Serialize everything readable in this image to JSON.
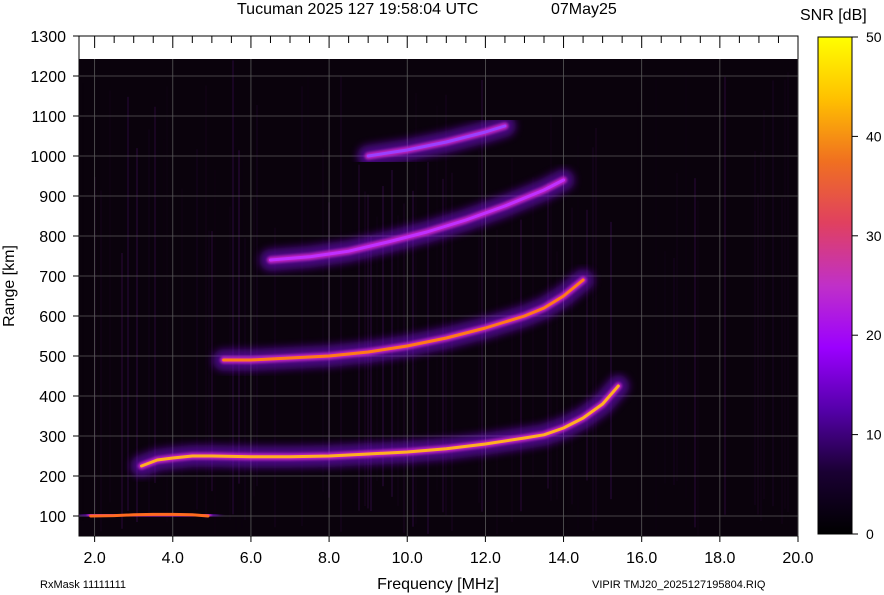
{
  "header": {
    "title": "Tucuman 2025 127 19:58:04 UTC",
    "date": "07May25",
    "colorbar_label": "SNR [dB]"
  },
  "footer": {
    "rxmask": "RxMask 11111111",
    "file": "VIPIR  TMJ20_2025127195804.RIQ"
  },
  "chart_data": {
    "type": "heatmap",
    "title": "Tucuman 2025 127 19:58:04 UTC",
    "xlabel": "Frequency [MHz]",
    "ylabel": "Range [km]",
    "xlim": [
      1.6,
      20.0
    ],
    "ylim": [
      50,
      1300
    ],
    "x_ticks": [
      "2.0",
      "4.0",
      "6.0",
      "8.0",
      "10.0",
      "12.0",
      "14.0",
      "16.0",
      "18.0",
      "20.0"
    ],
    "y_ticks": [
      "100",
      "200",
      "300",
      "400",
      "500",
      "600",
      "700",
      "800",
      "900",
      "1000",
      "1100",
      "1200",
      "1300"
    ],
    "colorbar": {
      "label": "SNR [dB]",
      "range": [
        0,
        50
      ],
      "ticks": [
        "0",
        "10",
        "20",
        "30",
        "40",
        "50"
      ],
      "colormap": [
        "#000000",
        "#1a0033",
        "#5500aa",
        "#9b00ff",
        "#c030c8",
        "#e04060",
        "#f07020",
        "#ffc000",
        "#ffff00"
      ]
    },
    "grid": true,
    "traces": [
      {
        "name": "",
        "x": [
          1.9,
          2.5,
          3.0,
          3.5,
          4.0,
          4.5,
          4.9
        ],
        "y": [
          100,
          101,
          103,
          104,
          104,
          103,
          100
        ]
      },
      {
        "name": "",
        "x": [
          3.2,
          3.6,
          4.0,
          4.5,
          5.0,
          6.0,
          7.0,
          8.0,
          9.0,
          10.0,
          11.0,
          12.0,
          13.0,
          13.5,
          14.0,
          14.5,
          15.0,
          15.4
        ],
        "y": [
          225,
          240,
          245,
          250,
          250,
          248,
          248,
          250,
          255,
          260,
          268,
          280,
          295,
          303,
          320,
          345,
          380,
          425
        ]
      },
      {
        "name": "",
        "x": [
          5.3,
          6.0,
          7.0,
          8.0,
          9.0,
          10.0,
          11.0,
          12.0,
          12.5,
          13.0,
          13.5,
          14.0,
          14.5
        ],
        "y": [
          490,
          490,
          495,
          500,
          510,
          525,
          545,
          570,
          585,
          600,
          620,
          650,
          690
        ]
      },
      {
        "name": "",
        "x": [
          6.5,
          7.5,
          8.5,
          9.5,
          10.5,
          11.5,
          12.5,
          13.5,
          14.0
        ],
        "y": [
          740,
          748,
          762,
          785,
          810,
          840,
          875,
          915,
          940
        ]
      },
      {
        "name": "",
        "x": [
          9.0,
          10.0,
          11.0,
          12.0,
          12.5
        ],
        "y": [
          1000,
          1015,
          1035,
          1060,
          1075
        ]
      }
    ]
  }
}
